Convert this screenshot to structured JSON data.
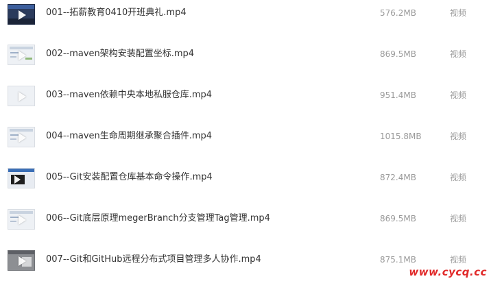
{
  "files": [
    {
      "name": "001--拓薪教育0410开班典礼.mp4",
      "size": "576.2MB",
      "type": "视频",
      "thumbnail": "dark-video-thumbnail"
    },
    {
      "name": "002--maven架构安装配置坐标.mp4",
      "size": "869.5MB",
      "type": "视频",
      "thumbnail": "light-screen-thumbnail"
    },
    {
      "name": "003--maven依赖中央本地私服仓库.mp4",
      "size": "951.4MB",
      "type": "视频",
      "thumbnail": "blank-screen-thumbnail"
    },
    {
      "name": "004--maven生命周期继承聚合插件.mp4",
      "size": "1015.8MB",
      "type": "视频",
      "thumbnail": "light-screen-thumbnail"
    },
    {
      "name": "005--Git安装配置仓库基本命令操作.mp4",
      "size": "872.4MB",
      "type": "视频",
      "thumbnail": "screen-with-player-thumbnail"
    },
    {
      "name": "006--Git底层原理megerBranch分支管理Tag管理.mp4",
      "size": "869.5MB",
      "type": "视频",
      "thumbnail": "light-screen-thumbnail"
    },
    {
      "name": "007--Git和GitHub远程分布式项目管理多人协作.mp4",
      "size": "875.1MB",
      "type": "视频",
      "thumbnail": "gray-screen-thumbnail"
    }
  ],
  "watermark": "www.cycq.cc",
  "colors": {
    "name_text": "#333333",
    "meta_text": "#9a9a9a",
    "watermark": "#e12a2a"
  }
}
